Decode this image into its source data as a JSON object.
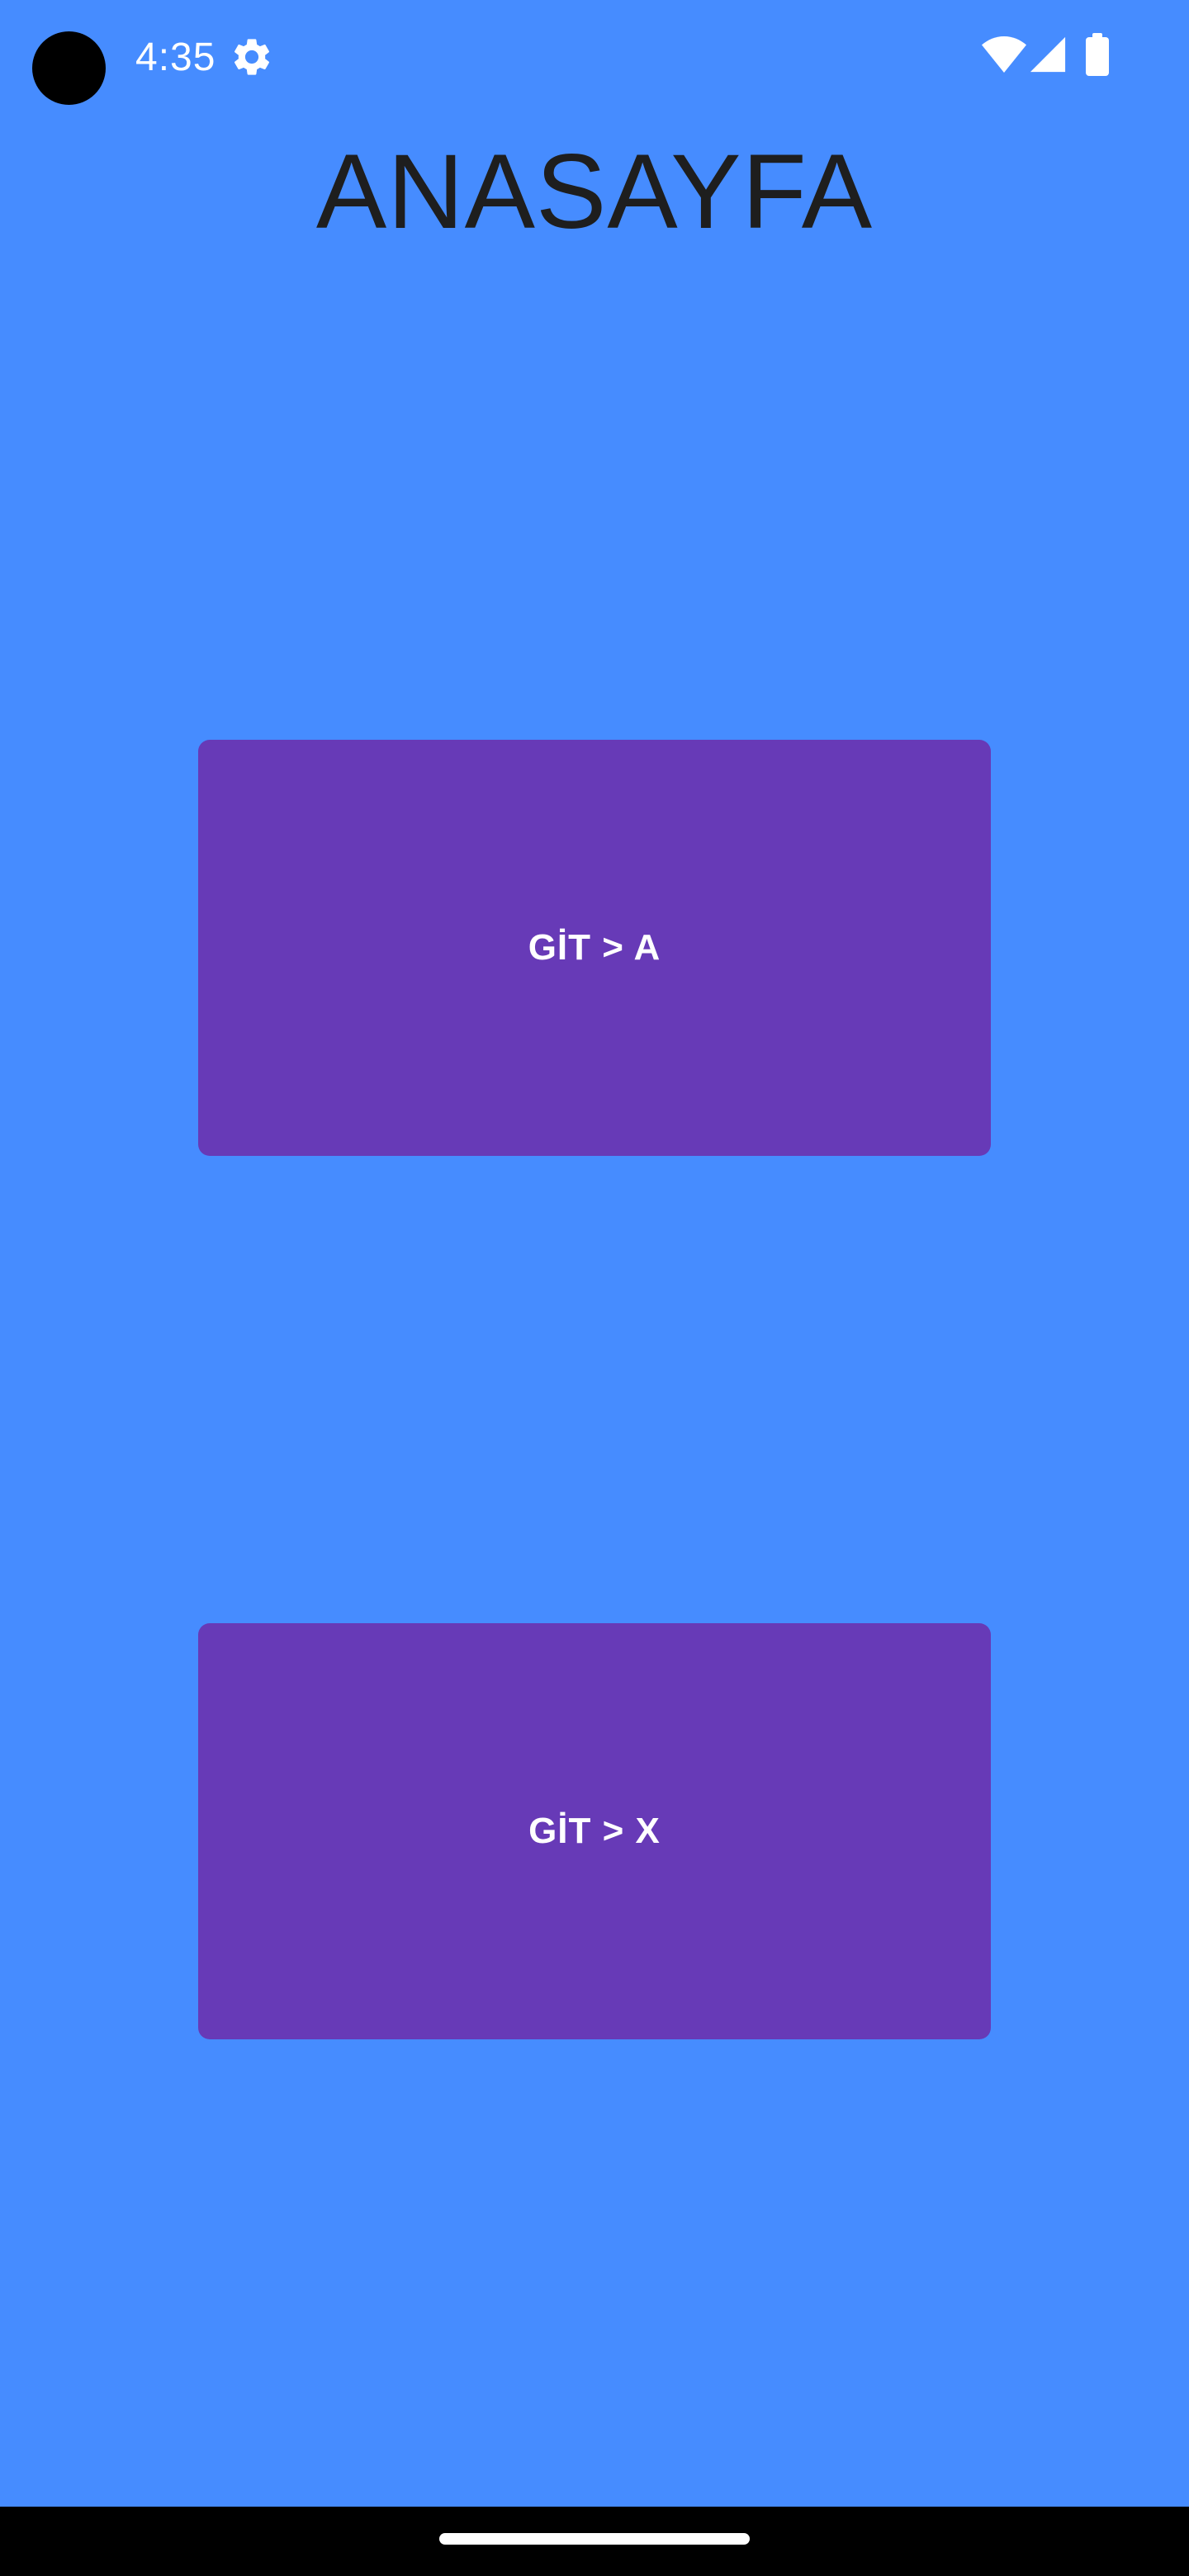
{
  "status_bar": {
    "time": "4:35",
    "icons": [
      "camera-cutout",
      "settings-icon",
      "wifi-icon",
      "signal-icon",
      "battery-icon"
    ]
  },
  "page": {
    "title": "ANASAYFA",
    "background_color": "#468cff"
  },
  "buttons": [
    {
      "label": "GİT > A",
      "color": "#673ab7"
    },
    {
      "label": "GİT > X",
      "color": "#673ab7"
    }
  ],
  "nav_bar": {
    "icon": "home-handle"
  }
}
